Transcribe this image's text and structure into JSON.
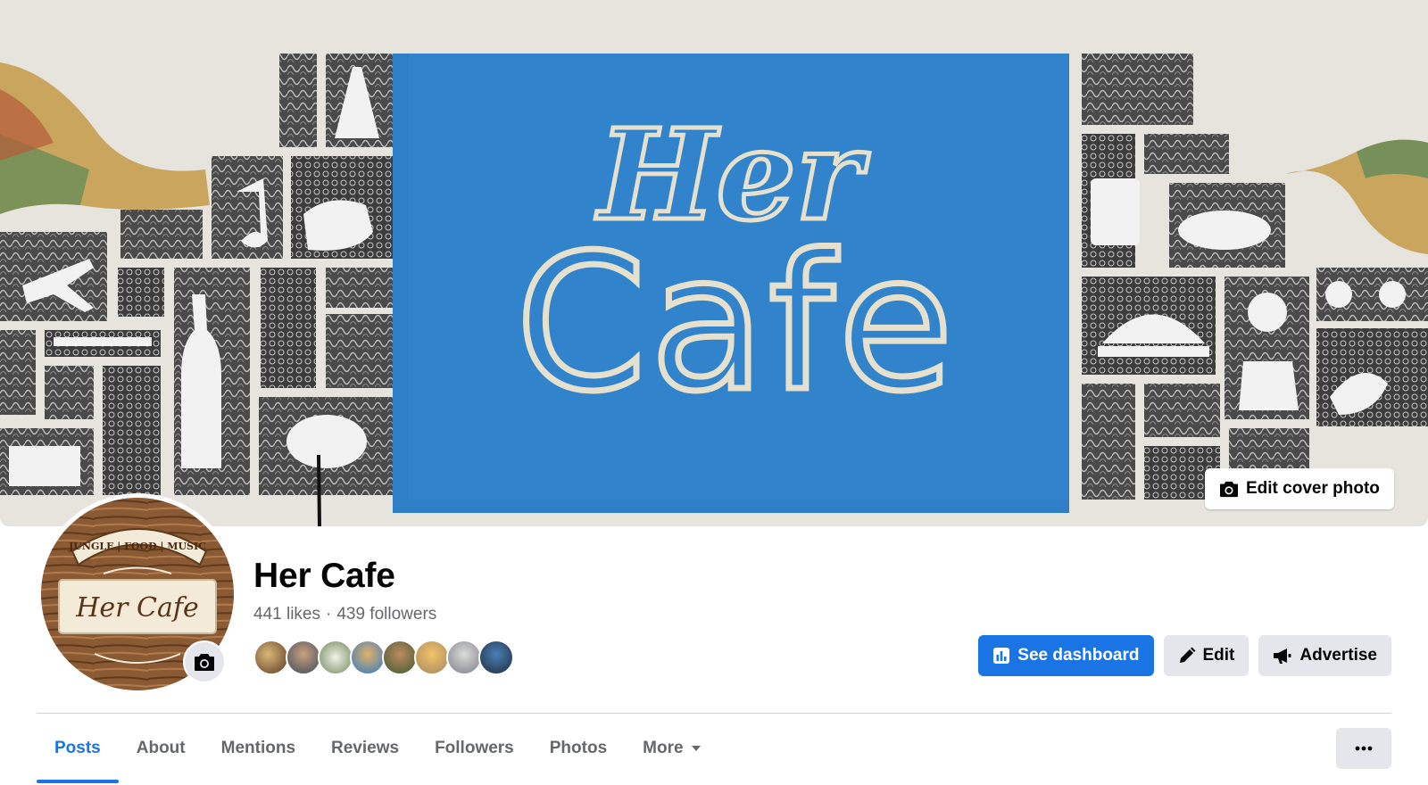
{
  "cover": {
    "sign_line1": "Her",
    "sign_line2": "Cafe",
    "edit_label": "Edit cover photo"
  },
  "profile": {
    "logo_banner": "JUNGLE | FOOD | MUSIC",
    "logo_text": "Her Cafe",
    "name": "Her Cafe",
    "likes": "441 likes",
    "separator": "·",
    "followers": "439 followers"
  },
  "actions": {
    "dashboard": "See dashboard",
    "edit": "Edit",
    "advertise": "Advertise"
  },
  "tabs": [
    {
      "label": "Posts",
      "active": true
    },
    {
      "label": "About"
    },
    {
      "label": "Mentions"
    },
    {
      "label": "Reviews"
    },
    {
      "label": "Followers"
    },
    {
      "label": "Photos"
    },
    {
      "label": "More"
    }
  ],
  "colors": {
    "accent": "#1b74e4",
    "button_grey": "#e4e6eb",
    "muted_text": "#65676b",
    "cover_blue": "#2f7fc7"
  },
  "icons": {
    "edit_cover": "camera-icon",
    "avatar_update": "camera-icon",
    "dashboard": "bar-chart-icon",
    "edit": "pencil-icon",
    "advertise": "megaphone-icon",
    "more_tab": "caret-down-icon",
    "overflow": "ellipsis-icon"
  }
}
